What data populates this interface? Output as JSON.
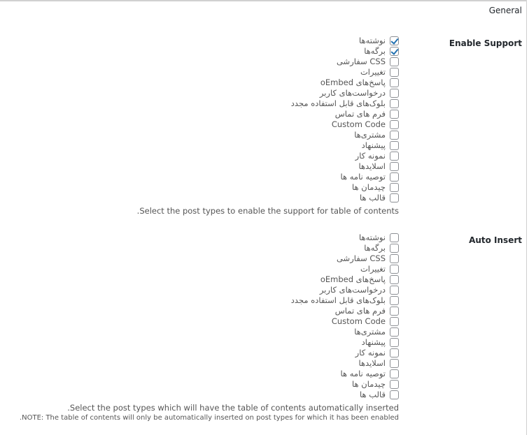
{
  "section": {
    "title": "General"
  },
  "enable_support": {
    "label": "Enable Support",
    "options": [
      {
        "label": "نوشته‌ها",
        "checked": true
      },
      {
        "label": "برگه‌ها",
        "checked": true
      },
      {
        "label": "CSS سفارشی",
        "checked": false
      },
      {
        "label": "تغییرات",
        "checked": false
      },
      {
        "label": "پاسخ‌های oEmbed",
        "checked": false
      },
      {
        "label": "درخواست‌های کاربر",
        "checked": false
      },
      {
        "label": "بلوک‌های قابل استفاده مجدد",
        "checked": false
      },
      {
        "label": "فرم های تماس",
        "checked": false
      },
      {
        "label": "Custom Code",
        "checked": false
      },
      {
        "label": "مشتری‌ها",
        "checked": false
      },
      {
        "label": "پیشنهاد",
        "checked": false
      },
      {
        "label": "نمونه کار",
        "checked": false
      },
      {
        "label": "اسلایدها",
        "checked": false
      },
      {
        "label": "توصیه نامه ها",
        "checked": false
      },
      {
        "label": "چیدمان ها",
        "checked": false
      },
      {
        "label": "قالب ها",
        "checked": false
      }
    ],
    "description": "Select the post types to enable the support for table of contents."
  },
  "auto_insert": {
    "label": "Auto Insert",
    "options": [
      {
        "label": "نوشته‌ها",
        "checked": false
      },
      {
        "label": "برگه‌ها",
        "checked": false
      },
      {
        "label": "CSS سفارشی",
        "checked": false
      },
      {
        "label": "تغییرات",
        "checked": false
      },
      {
        "label": "پاسخ‌های oEmbed",
        "checked": false
      },
      {
        "label": "درخواست‌های کاربر",
        "checked": false
      },
      {
        "label": "بلوک‌های قابل استفاده مجدد",
        "checked": false
      },
      {
        "label": "فرم های تماس",
        "checked": false
      },
      {
        "label": "Custom Code",
        "checked": false
      },
      {
        "label": "مشتری‌ها",
        "checked": false
      },
      {
        "label": "پیشنهاد",
        "checked": false
      },
      {
        "label": "نمونه کار",
        "checked": false
      },
      {
        "label": "اسلایدها",
        "checked": false
      },
      {
        "label": "توصیه نامه ها",
        "checked": false
      },
      {
        "label": "چیدمان ها",
        "checked": false
      },
      {
        "label": "قالب ها",
        "checked": false
      }
    ],
    "description": "Select the post types which will have the table of contents automatically inserted.",
    "note": "NOTE: The table of contents will only be automatically inserted on post types for which it has been enabled."
  },
  "colors": {
    "checkmark": "#2271b1",
    "checkbox_border": "#8c8f94",
    "label_text": "#23282d",
    "body_text": "#555555"
  }
}
